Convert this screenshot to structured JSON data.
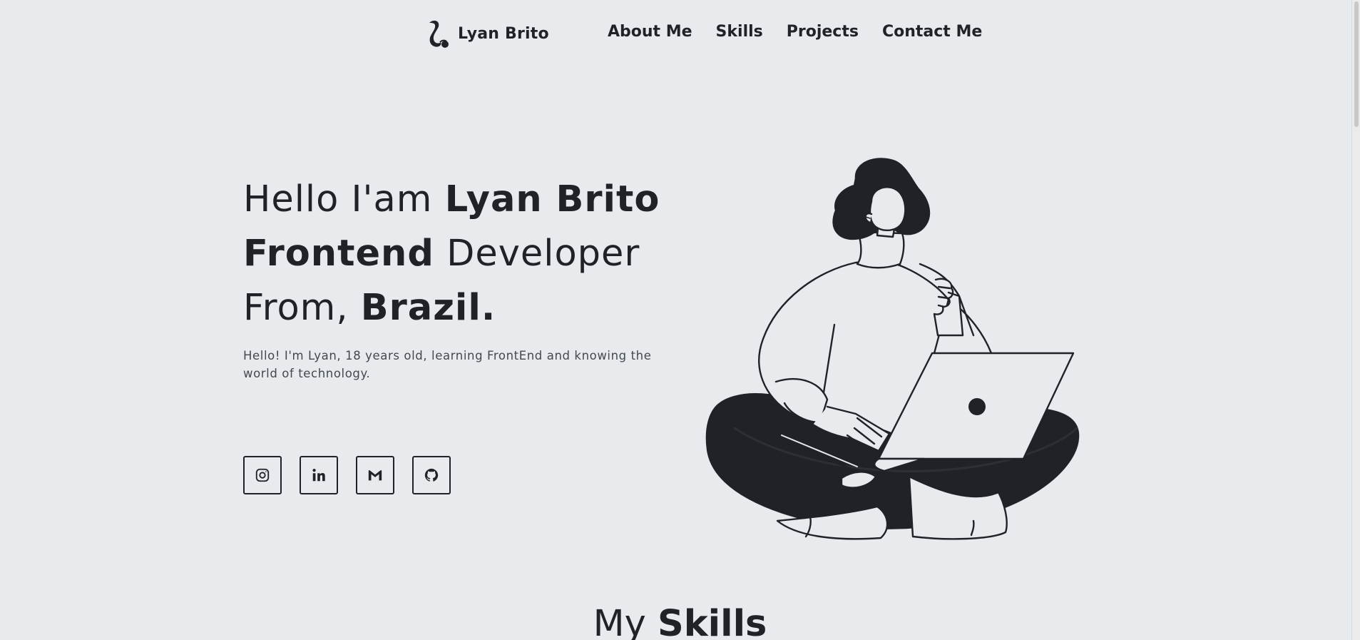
{
  "header": {
    "logo_text": "Lyan Brito",
    "nav": [
      {
        "label": "About Me"
      },
      {
        "label": "Skills"
      },
      {
        "label": "Projects"
      },
      {
        "label": "Contact Me"
      }
    ]
  },
  "hero": {
    "line1_light": "Hello I'am ",
    "line1_bold": "Lyan Brito",
    "line2_bold": "Frontend",
    "line2_light": " Developer",
    "line3_light": "From, ",
    "line3_bold": "Brazil.",
    "description": "Hello! I'm Lyan, 18 years old, learning FrontEnd and knowing the world of technology."
  },
  "socials": [
    {
      "icon": "instagram-icon"
    },
    {
      "icon": "linkedin-icon"
    },
    {
      "icon": "gmail-icon"
    },
    {
      "icon": "github-icon"
    }
  ],
  "skills_section": {
    "heading_light": "My ",
    "heading_bold": "Skills"
  },
  "colors": {
    "background": "#e8ebee",
    "text": "#1f2226",
    "muted_text": "#44484d"
  }
}
